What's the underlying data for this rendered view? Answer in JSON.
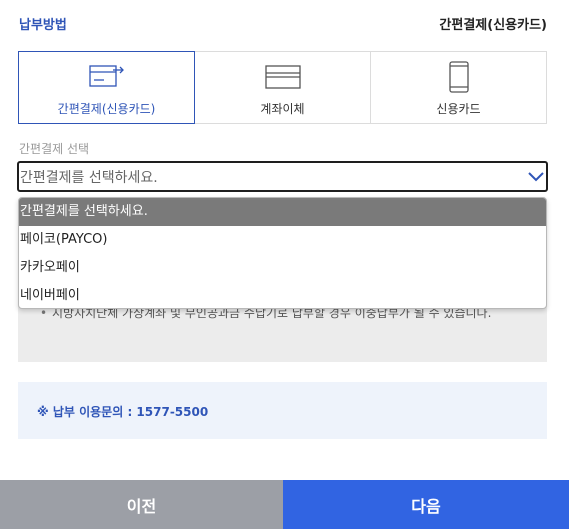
{
  "header": {
    "label": "납부방법",
    "selected_method": "간편결제(신용카드)"
  },
  "methods": [
    {
      "label": "간편결제(신용카드)",
      "icon": "easy-pay-card-icon"
    },
    {
      "label": "계좌이체",
      "icon": "bank-card-icon"
    },
    {
      "label": "신용카드",
      "icon": "mobile-phone-icon"
    }
  ],
  "easy_pay": {
    "title": "간편결제 선택",
    "selected": "간편결제를 선택하세요.",
    "options": [
      "간편결제를 선택하세요.",
      "페이코(PAYCO)",
      "카카오페이",
      "네이버페이"
    ]
  },
  "notice": {
    "bullet": "지방자치단체 가상계좌 및 무인공과금 수납기로 납부할 경우 이중납부가 될 수 있습니다."
  },
  "contact": {
    "text": "※ 납부 이용문의 : 1577-5500"
  },
  "footer": {
    "prev": "이전",
    "next": "다음"
  },
  "colors": {
    "accent": "#2f55b7",
    "next_button": "#3164e2",
    "prev_button": "#9c9fa6"
  }
}
